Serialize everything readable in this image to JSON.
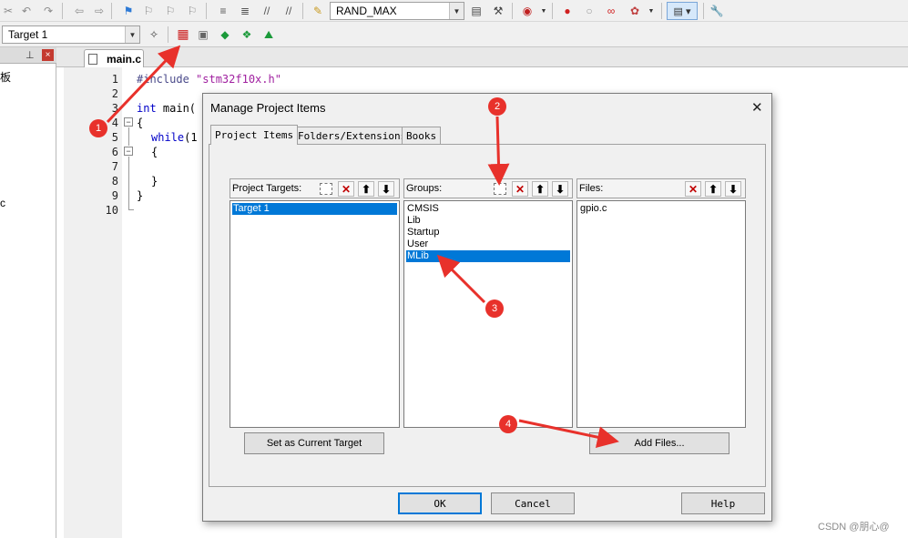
{
  "toolbar": {
    "symbol_combo_value": "RAND_MAX",
    "target_combo_value": "Target 1"
  },
  "left_panel": {
    "text_top": "板",
    "text_mid": "c"
  },
  "editor": {
    "tab_label": "main.c",
    "line_numbers": [
      "1",
      "2",
      "3",
      "4",
      "5",
      "6",
      "7",
      "8",
      "9",
      "10"
    ],
    "lines": {
      "l1_directive": "#include",
      "l1_file": "\"stm32f10x.h\"",
      "l3_type": "int",
      "l3_rest": " main(",
      "l4": "{",
      "l5_kw": "while",
      "l5_rest": "(1",
      "l6": "{",
      "l8": "}",
      "l9": "}"
    }
  },
  "dialog": {
    "title": "Manage Project Items",
    "tabs": [
      "Project Items",
      "Folders/Extensions",
      "Books"
    ],
    "targets_label": "Project Targets:",
    "targets": [
      "Target 1"
    ],
    "groups_label": "Groups:",
    "groups": [
      "CMSIS",
      "Lib",
      "Startup",
      "User",
      "MLib"
    ],
    "files_label": "Files:",
    "files": [
      "gpio.c"
    ],
    "set_current_label": "Set as Current Target",
    "add_files_label": "Add Files...",
    "ok_label": "OK",
    "cancel_label": "Cancel",
    "help_label": "Help"
  },
  "annotations": {
    "step1": "1",
    "step2": "2",
    "step3": "3",
    "step4": "4",
    "color": "#e8312b"
  },
  "watermark": "CSDN @朋心@"
}
